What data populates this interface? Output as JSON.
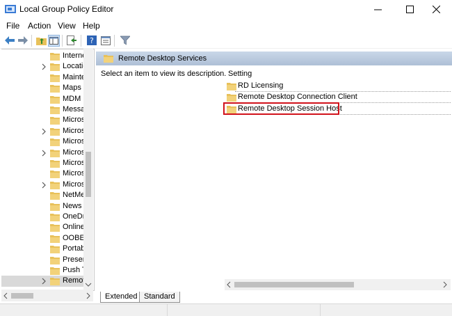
{
  "window": {
    "title": "Local Group Policy Editor",
    "minimize_glyph": "—",
    "maximize_glyph": "☐",
    "close_glyph": "✕"
  },
  "menu": [
    "File",
    "Action",
    "View",
    "Help"
  ],
  "toolbar_icons": [
    "back-arrow-icon",
    "forward-arrow-icon",
    "up-folder-icon",
    "show-hide-tree-icon",
    "export-list-icon",
    "help-icon",
    "properties-icon",
    "filter-icon"
  ],
  "tree": {
    "items": [
      {
        "label": "Interne",
        "expandable": false
      },
      {
        "label": "Locatio",
        "expandable": true
      },
      {
        "label": "Mainte",
        "expandable": false
      },
      {
        "label": "Maps",
        "expandable": false
      },
      {
        "label": "MDM",
        "expandable": false
      },
      {
        "label": "Messag",
        "expandable": false
      },
      {
        "label": "Micros",
        "expandable": false
      },
      {
        "label": "Micros",
        "expandable": true
      },
      {
        "label": "Micros",
        "expandable": false
      },
      {
        "label": "Micros",
        "expandable": true
      },
      {
        "label": "Micros",
        "expandable": false
      },
      {
        "label": "Micros",
        "expandable": false
      },
      {
        "label": "Micros",
        "expandable": true
      },
      {
        "label": "NetMe",
        "expandable": false
      },
      {
        "label": "News a",
        "expandable": false
      },
      {
        "label": "OneDr",
        "expandable": false
      },
      {
        "label": "Online",
        "expandable": false
      },
      {
        "label": "OOBE",
        "expandable": false
      },
      {
        "label": "Portab",
        "expandable": false
      },
      {
        "label": "Presen",
        "expandable": false
      },
      {
        "label": "Push T",
        "expandable": false
      },
      {
        "label": "Remot",
        "expandable": true,
        "selected": true
      }
    ]
  },
  "details": {
    "header": "Remote Desktop Services",
    "description": "Select an item to view its description.",
    "column": "Setting",
    "rows": [
      "RD Licensing",
      "Remote Desktop Connection Client",
      "Remote Desktop Session Host"
    ],
    "highlighted_row": "Remote Desktop Session Host"
  },
  "tabs": {
    "extended": "Extended",
    "standard": "Standard"
  },
  "colors": {
    "highlight_border": "#d1121b",
    "folder": "#e8c15a",
    "header": "#b7c8dd"
  }
}
